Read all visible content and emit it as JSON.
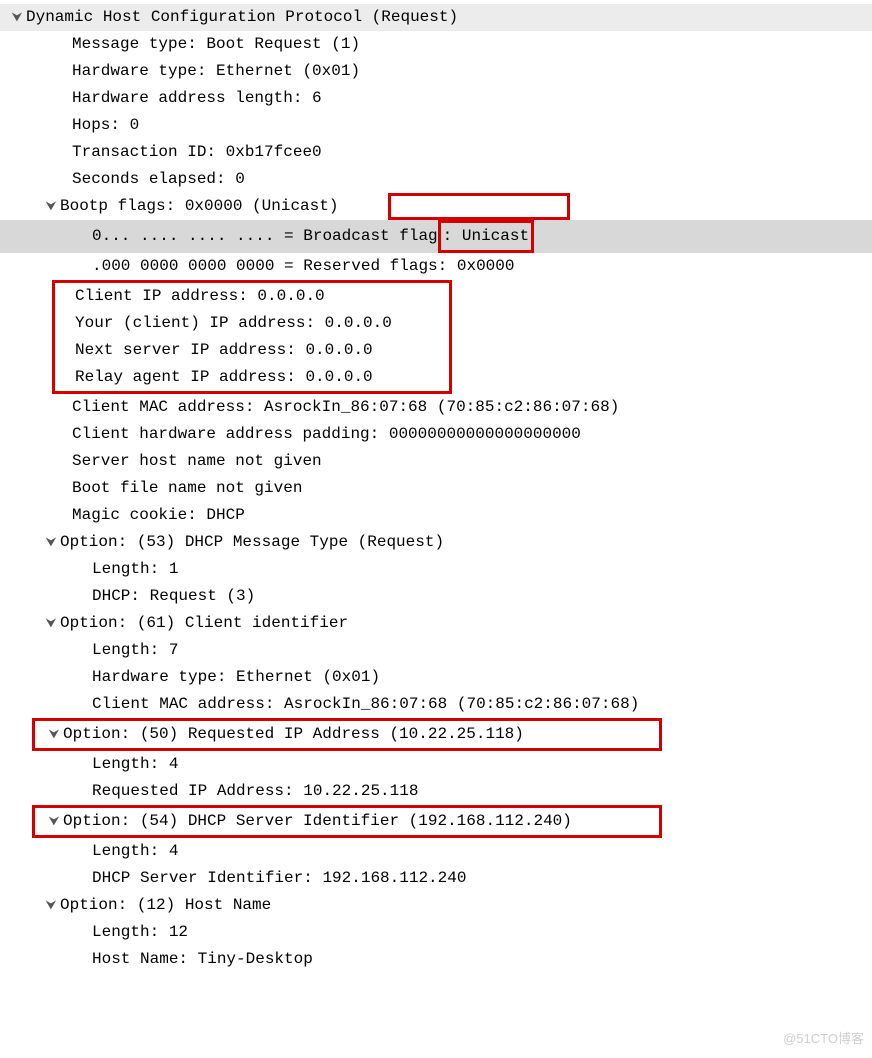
{
  "header": "Dynamic Host Configuration Protocol (Request)",
  "fields": {
    "msg_type": "Message type: Boot Request (1)",
    "hw_type": "Hardware type: Ethernet (0x01)",
    "hw_addr_len": "Hardware address length: 6",
    "hops": "Hops: 0",
    "txid": "Transaction ID: 0xb17fcee0",
    "seconds": "Seconds elapsed: 0",
    "bootp_flags": "Bootp flags: 0x0000 (Unicast)",
    "broadcast_flag_prefix": "0... .... .... .... = Broadcast flag",
    "broadcast_flag_colon": ": ",
    "broadcast_flag_value": "Unicast",
    "reserved_flags": ".000 0000 0000 0000 = Reserved flags: 0x0000",
    "client_ip": "Client IP address: 0.0.0.0",
    "your_ip": "Your (client) IP address: 0.0.0.0",
    "next_server_ip": "Next server IP address: 0.0.0.0",
    "relay_ip": "Relay agent IP address: 0.0.0.0",
    "client_mac": "Client MAC address: AsrockIn_86:07:68 (70:85:c2:86:07:68)",
    "padding": "Client hardware address padding: 00000000000000000000",
    "server_host": "Server host name not given",
    "boot_file": "Boot file name not given",
    "magic_cookie": "Magic cookie: DHCP"
  },
  "options": {
    "opt53": {
      "title": "Option: (53) DHCP Message Type (Request)",
      "length": "Length: 1",
      "value": "DHCP: Request (3)"
    },
    "opt61": {
      "title": "Option: (61) Client identifier",
      "length": "Length: 7",
      "hw_type": "Hardware type: Ethernet (0x01)",
      "mac": "Client MAC address: AsrockIn_86:07:68 (70:85:c2:86:07:68)"
    },
    "opt50": {
      "title": "Option: (50) Requested IP Address (10.22.25.118)",
      "length": "Length: 4",
      "value": "Requested IP Address: 10.22.25.118"
    },
    "opt54": {
      "title": "Option: (54) DHCP Server Identifier (192.168.112.240)",
      "length": "Length: 4",
      "value": "DHCP Server Identifier: 192.168.112.240"
    },
    "opt12": {
      "title": "Option: (12) Host Name",
      "length": "Length: 12",
      "value": "Host Name: Tiny-Desktop"
    }
  },
  "watermark": "@51CTO博客"
}
